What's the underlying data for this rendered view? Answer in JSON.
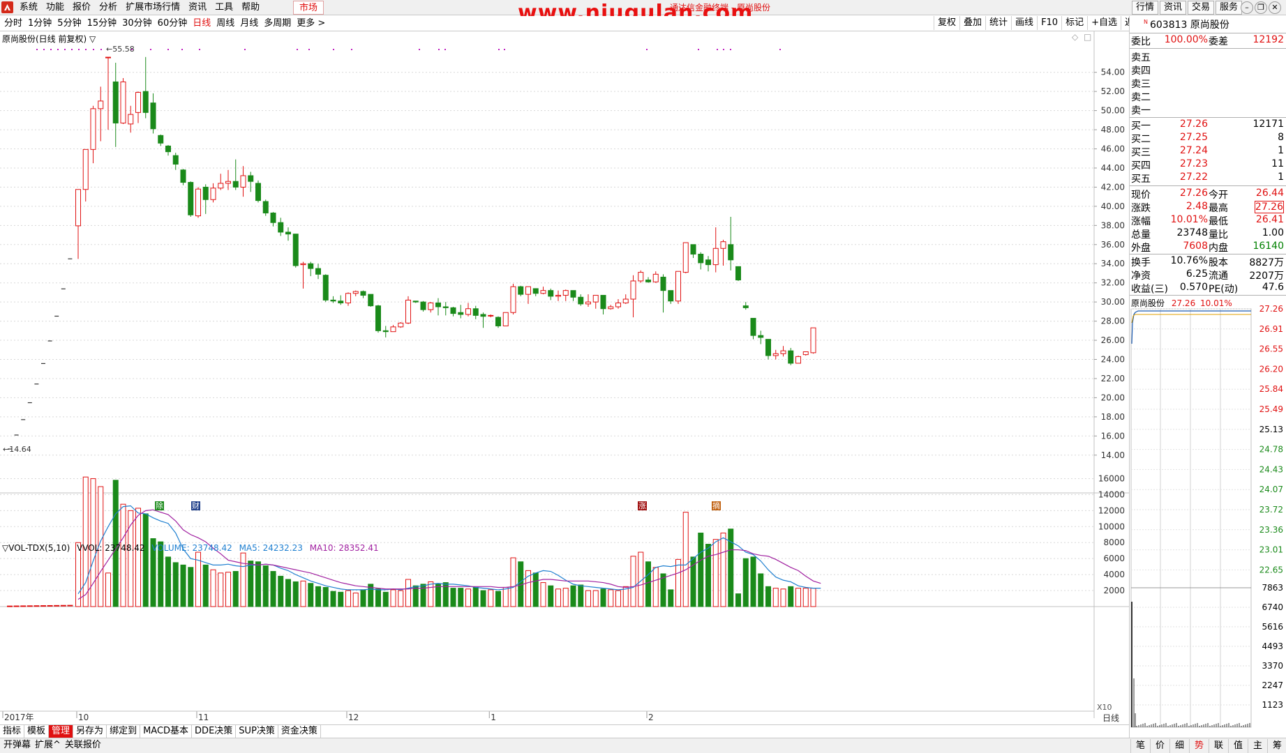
{
  "menu": {
    "items": [
      "系统",
      "功能",
      "报价",
      "分析",
      "扩展市场行情",
      "资讯",
      "工具",
      "帮助"
    ],
    "market": "市场",
    "watermark": "www.niugulan.com",
    "window_title": "通达信金融终端 - 原尚股份",
    "right_buttons": [
      "行情",
      "资讯",
      "交易",
      "服务"
    ]
  },
  "periods": {
    "items": [
      "分时",
      "1分钟",
      "5分钟",
      "15分钟",
      "30分钟",
      "60分钟",
      "日线",
      "周线",
      "月线",
      "多周期",
      "更多 >"
    ],
    "active": "日线"
  },
  "tools": [
    "复权",
    "叠加",
    "统计",
    "画线",
    "F10",
    "标记",
    "+自选",
    "返回"
  ],
  "chart_title": "原尚股份(日线 前复权) ▽",
  "volume_title": {
    "name": "▽VOL-TDX(5,10)",
    "vvol": "VVOL: 23748.42",
    "volume": "VOLUME: 23748.42",
    "ma5": "MA5: 24232.23",
    "ma10": "MA10: 28352.41"
  },
  "chart_data": {
    "type": "candlestick",
    "price_axis": [
      "54.00",
      "52.00",
      "50.00",
      "48.00",
      "46.00",
      "44.00",
      "42.00",
      "40.00",
      "38.00",
      "36.00",
      "34.00",
      "32.00",
      "30.00",
      "28.00",
      "26.00",
      "24.00",
      "22.00",
      "20.00",
      "18.00",
      "16.00",
      "14.00"
    ],
    "price_range": [
      13.4,
      55.8
    ],
    "volume_axis": [
      "16000",
      "14000",
      "12000",
      "10000",
      "8000",
      "6000",
      "4000",
      "2000"
    ],
    "volume_range": [
      0,
      17000
    ],
    "max_label": "55.58",
    "min_label": "14.64",
    "time_labels": [
      "2017年",
      "10",
      "11",
      "12",
      "1",
      "2"
    ],
    "time_label_index": [
      -12,
      0,
      16,
      36,
      55,
      76
    ],
    "x10_label": "X10",
    "period_label": "日线",
    "ipo_ramp": [
      14.64,
      16.1,
      17.71,
      19.48,
      21.43,
      23.57,
      25.93,
      28.52,
      31.37,
      34.51
    ],
    "candles": [
      [
        37.96,
        41.76,
        34.5,
        41.76,
        8000
      ],
      [
        41.76,
        45.94,
        40.5,
        45.94,
        16200
      ],
      [
        45.94,
        50.2,
        44.5,
        50.5,
        16000
      ],
      [
        50.2,
        51.0,
        46.8,
        52.5,
        15000
      ],
      [
        55.58,
        55.58,
        48.0,
        55.58,
        4200
      ],
      [
        53.0,
        48.7,
        46.2,
        55.0,
        15800
      ],
      [
        48.7,
        53.0,
        48.6,
        53.4,
        12800
      ],
      [
        48.6,
        49.6,
        47.7,
        50.5,
        12000
      ],
      [
        49.8,
        51.9,
        48.7,
        52.0,
        12300
      ],
      [
        52.0,
        49.8,
        49.2,
        55.6,
        11600
      ],
      [
        50.8,
        48.1,
        47.6,
        51.8,
        8500
      ],
      [
        47.4,
        46.6,
        46.3,
        47.5,
        8100
      ],
      [
        46.3,
        45.7,
        45.3,
        46.4,
        6200
      ],
      [
        45.3,
        44.4,
        43.8,
        45.6,
        5500
      ],
      [
        43.8,
        42.5,
        42.2,
        43.9,
        5200
      ],
      [
        42.5,
        39.1,
        38.9,
        42.6,
        4900
      ],
      [
        39.0,
        41.8,
        38.8,
        42.0,
        6800
      ],
      [
        42.0,
        40.7,
        39.2,
        42.3,
        5200
      ],
      [
        40.7,
        41.9,
        40.4,
        42.4,
        4600
      ],
      [
        41.9,
        42.4,
        41.7,
        43.4,
        4200
      ],
      [
        42.4,
        42.6,
        41.7,
        43.8,
        4300
      ],
      [
        42.6,
        42.0,
        41.7,
        44.9,
        4400
      ],
      [
        42.0,
        43.2,
        41.0,
        44.2,
        6700
      ],
      [
        43.2,
        42.6,
        41.5,
        43.6,
        5700
      ],
      [
        42.4,
        40.6,
        40.4,
        42.7,
        5600
      ],
      [
        40.5,
        39.3,
        39.0,
        40.7,
        5100
      ],
      [
        39.3,
        38.3,
        37.9,
        39.4,
        4400
      ],
      [
        38.3,
        37.3,
        36.9,
        38.8,
        3800
      ],
      [
        37.3,
        37.1,
        36.4,
        37.8,
        3400
      ],
      [
        37.1,
        33.8,
        33.6,
        37.1,
        3100
      ],
      [
        33.9,
        34.0,
        31.4,
        34.2,
        3200
      ],
      [
        34.0,
        33.5,
        32.7,
        34.2,
        2900
      ],
      [
        33.5,
        32.9,
        32.4,
        34.0,
        2500
      ],
      [
        32.8,
        30.2,
        30.0,
        32.9,
        2400
      ],
      [
        30.2,
        30.1,
        29.9,
        30.6,
        1900
      ],
      [
        30.1,
        29.9,
        29.7,
        30.7,
        1800
      ],
      [
        29.9,
        30.9,
        29.6,
        31.0,
        2000
      ],
      [
        30.9,
        31.1,
        30.6,
        31.2,
        1700
      ],
      [
        31.1,
        30.7,
        30.4,
        31.2,
        2100
      ],
      [
        30.8,
        29.6,
        29.5,
        30.8,
        2800
      ],
      [
        29.6,
        27.0,
        26.8,
        29.7,
        2200
      ],
      [
        27.0,
        26.9,
        26.3,
        27.5,
        1800
      ],
      [
        26.9,
        27.4,
        27.1,
        27.6,
        2100
      ],
      [
        27.4,
        27.8,
        27.3,
        27.9,
        2000
      ],
      [
        27.8,
        30.2,
        27.7,
        30.6,
        3400
      ],
      [
        30.1,
        30.0,
        29.9,
        30.1,
        2600
      ],
      [
        30.0,
        29.2,
        29.0,
        30.1,
        2800
      ],
      [
        29.2,
        29.9,
        28.9,
        30.0,
        3100
      ],
      [
        29.9,
        29.5,
        28.6,
        30.4,
        2800
      ],
      [
        29.5,
        29.4,
        28.6,
        30.0,
        3000
      ],
      [
        29.4,
        28.8,
        28.5,
        29.5,
        2300
      ],
      [
        28.9,
        28.7,
        28.3,
        29.7,
        2300
      ],
      [
        28.7,
        29.3,
        28.5,
        29.9,
        2200
      ],
      [
        29.3,
        28.6,
        28.2,
        29.6,
        2400
      ],
      [
        28.7,
        28.5,
        27.3,
        28.9,
        2000
      ],
      [
        28.6,
        28.6,
        28.4,
        28.7,
        2100
      ],
      [
        28.4,
        27.5,
        27.3,
        28.5,
        1900
      ],
      [
        27.5,
        28.9,
        27.7,
        28.9,
        2400
      ],
      [
        28.9,
        31.6,
        28.7,
        31.9,
        6100
      ],
      [
        31.6,
        30.8,
        30.6,
        31.7,
        5600
      ],
      [
        30.8,
        31.6,
        29.8,
        31.6,
        4500
      ],
      [
        31.4,
        30.9,
        30.6,
        31.4,
        4200
      ],
      [
        30.9,
        31.2,
        30.8,
        31.6,
        3000
      ],
      [
        31.2,
        30.6,
        30.2,
        31.4,
        2600
      ],
      [
        30.6,
        30.7,
        30.1,
        31.2,
        2200
      ],
      [
        30.7,
        31.2,
        30.1,
        31.3,
        2300
      ],
      [
        31.2,
        30.5,
        30.1,
        31.2,
        2600
      ],
      [
        30.5,
        29.8,
        29.6,
        30.8,
        2700
      ],
      [
        29.8,
        30.0,
        29.5,
        30.8,
        2000
      ],
      [
        30.0,
        30.7,
        29.3,
        30.7,
        2000
      ],
      [
        30.7,
        29.3,
        28.7,
        30.7,
        2200
      ],
      [
        29.3,
        29.5,
        29.2,
        29.7,
        2100
      ],
      [
        29.5,
        29.9,
        29.3,
        30.3,
        2000
      ],
      [
        29.9,
        30.3,
        29.8,
        30.8,
        2500
      ],
      [
        30.3,
        32.2,
        28.4,
        32.8,
        6300
      ],
      [
        32.2,
        33.1,
        32.0,
        33.3,
        6800
      ],
      [
        32.3,
        32.1,
        32.0,
        32.6,
        5600
      ],
      [
        32.1,
        32.9,
        32.0,
        33.2,
        4900
      ],
      [
        32.6,
        31.2,
        28.9,
        32.9,
        4100
      ],
      [
        31.2,
        30.1,
        29.8,
        31.2,
        2100
      ],
      [
        30.1,
        33.2,
        29.8,
        33.2,
        5900
      ],
      [
        33.1,
        36.2,
        33.0,
        36.2,
        11800
      ],
      [
        36.0,
        35.0,
        34.6,
        35.8,
        6200
      ],
      [
        35.0,
        34.1,
        33.4,
        35.2,
        9200
      ],
      [
        34.4,
        33.9,
        33.2,
        34.8,
        7800
      ],
      [
        33.9,
        35.6,
        33.1,
        37.8,
        8400
      ],
      [
        35.6,
        36.3,
        33.8,
        36.5,
        9200
      ],
      [
        36.0,
        34.4,
        33.3,
        38.9,
        9700
      ],
      [
        33.7,
        32.3,
        32.2,
        33.7,
        1600
      ],
      [
        29.6,
        29.4,
        29.2,
        30.0,
        6000
      ],
      [
        28.3,
        26.5,
        26.1,
        28.3,
        6200
      ],
      [
        26.5,
        26.3,
        25.6,
        27.0,
        4100
      ],
      [
        26.1,
        24.4,
        24.0,
        26.1,
        2500
      ],
      [
        24.4,
        24.6,
        24.0,
        25.0,
        2300
      ],
      [
        24.6,
        24.9,
        24.3,
        25.4,
        2200
      ],
      [
        24.9,
        23.6,
        23.4,
        25.2,
        2500
      ],
      [
        23.6,
        24.3,
        23.7,
        24.4,
        2300
      ],
      [
        24.5,
        24.8,
        24.4,
        24.8,
        2300
      ],
      [
        24.7,
        27.3,
        24.6,
        27.3,
        2300
      ]
    ],
    "ma5": [
      1600,
      3000,
      5700,
      8200,
      10000,
      11600,
      12500,
      12600,
      11700,
      11600,
      11100,
      10700,
      10400,
      9200,
      7200,
      6000,
      5800,
      5500,
      5200,
      5200,
      5300,
      5100,
      5000,
      5200,
      5200,
      5300,
      5200,
      4800,
      4500,
      4000,
      3600,
      3200,
      2900,
      2600,
      2400,
      2200,
      2100,
      2100,
      2100,
      2200,
      2100,
      2100,
      2200,
      2100,
      2300,
      2500,
      2600,
      2800,
      2900,
      2800,
      2800,
      2700,
      2600,
      2400,
      2300,
      2200,
      2100,
      2200,
      2400,
      3100,
      3800,
      4200,
      4500,
      4400,
      3900,
      3300,
      2800,
      2600,
      2500,
      2400,
      2300,
      2200,
      2100,
      2200,
      2400,
      3200,
      4000,
      4900,
      5100,
      5000,
      5200,
      5200,
      6000,
      6800,
      7300,
      8100,
      8600,
      8100,
      7600,
      6800,
      6500,
      5700,
      4600,
      3700,
      3300,
      3100,
      2600,
      2400,
      2300,
      2300
    ],
    "ma10": [
      900,
      1500,
      2900,
      4400,
      5800,
      7200,
      8600,
      10200,
      11400,
      12000,
      12100,
      11800,
      11500,
      10700,
      9600,
      9000,
      8600,
      8100,
      7300,
      6600,
      5800,
      5600,
      5400,
      5300,
      5200,
      5300,
      5200,
      5000,
      4800,
      4600,
      4400,
      4200,
      3900,
      3600,
      3300,
      3000,
      2800,
      2600,
      2500,
      2400,
      2300,
      2200,
      2200,
      2200,
      2200,
      2300,
      2300,
      2400,
      2500,
      2500,
      2500,
      2500,
      2500,
      2500,
      2500,
      2500,
      2400,
      2400,
      2500,
      2700,
      3000,
      3200,
      3400,
      3400,
      3300,
      3200,
      3200,
      3200,
      3200,
      3100,
      3000,
      2800,
      2500,
      2400,
      2500,
      2700,
      3000,
      3300,
      3600,
      3900,
      4200,
      4600,
      5200,
      5800,
      6300,
      6500,
      6800,
      7100,
      7100,
      7000,
      6600,
      6400,
      6300,
      5900,
      5400,
      4900,
      4500,
      3800,
      3200,
      2900
    ]
  },
  "markers": [
    "除",
    "财",
    "涨",
    "摘"
  ],
  "quote": {
    "code": "603813",
    "name": "原尚股份",
    "wb": {
      "label": "委比",
      "value": "100.00%",
      "label2": "委差",
      "value2": "12192"
    },
    "sell": [
      {
        "label": "卖五"
      },
      {
        "label": "卖四"
      },
      {
        "label": "卖三"
      },
      {
        "label": "卖二"
      },
      {
        "label": "卖一"
      }
    ],
    "buy": [
      {
        "label": "买一",
        "price": "27.26",
        "vol": "12171"
      },
      {
        "label": "买二",
        "price": "27.25",
        "vol": "8"
      },
      {
        "label": "买三",
        "price": "27.24",
        "vol": "1"
      },
      {
        "label": "买四",
        "price": "27.23",
        "vol": "11"
      },
      {
        "label": "买五",
        "price": "27.22",
        "vol": "1"
      }
    ],
    "stats": [
      {
        "l1": "现价",
        "v1": "27.26",
        "c1": "red",
        "l2": "今开",
        "v2": "26.44",
        "c2": "red"
      },
      {
        "l1": "涨跌",
        "v1": "2.48",
        "c1": "red",
        "l2": "最高",
        "v2": "27.26",
        "c2": "red"
      },
      {
        "l1": "涨幅",
        "v1": "10.01%",
        "c1": "red",
        "l2": "最低",
        "v2": "26.41",
        "c2": "red"
      },
      {
        "l1": "总量",
        "v1": "23748",
        "c1": "black",
        "l2": "量比",
        "v2": "1.00",
        "c2": "black"
      },
      {
        "l1": "外盘",
        "v1": "7608",
        "c1": "red",
        "l2": "内盘",
        "v2": "16140",
        "c2": "green"
      }
    ],
    "fund": [
      {
        "l1": "换手",
        "v1": "10.76%",
        "l2": "股本",
        "v2": "8827万"
      },
      {
        "l1": "净资",
        "v1": "6.25",
        "l2": "流通",
        "v2": "2207万"
      },
      {
        "l1": "收益(三)",
        "v1": "0.570",
        "l2": "PE(动)",
        "v2": "47.6"
      }
    ]
  },
  "mini": {
    "title_name": "原尚股份",
    "title_price": "27.26",
    "title_pct": "10.01%",
    "price_labels": [
      "27.26",
      "26.91",
      "26.55",
      "26.20",
      "25.84",
      "25.49",
      "25.13",
      "24.78",
      "24.43",
      "24.07",
      "23.72",
      "23.36",
      "23.01",
      "22.65"
    ],
    "vol_labels": [
      "7863",
      "6740",
      "5616",
      "4493",
      "3370",
      "2247",
      "1123"
    ]
  },
  "bottom_tabs": [
    "指标",
    "模板",
    "管理",
    "另存为",
    "绑定到",
    "MACD基本",
    "DDE决策",
    "SUP决策",
    "资金决策"
  ],
  "bottom_active": "管理",
  "status_left": [
    "开弹幕",
    "扩展^",
    "关联报价"
  ],
  "status_right": [
    "笔",
    "价",
    "细",
    "势",
    "联",
    "值",
    "主",
    "筹"
  ],
  "status_active": "势"
}
